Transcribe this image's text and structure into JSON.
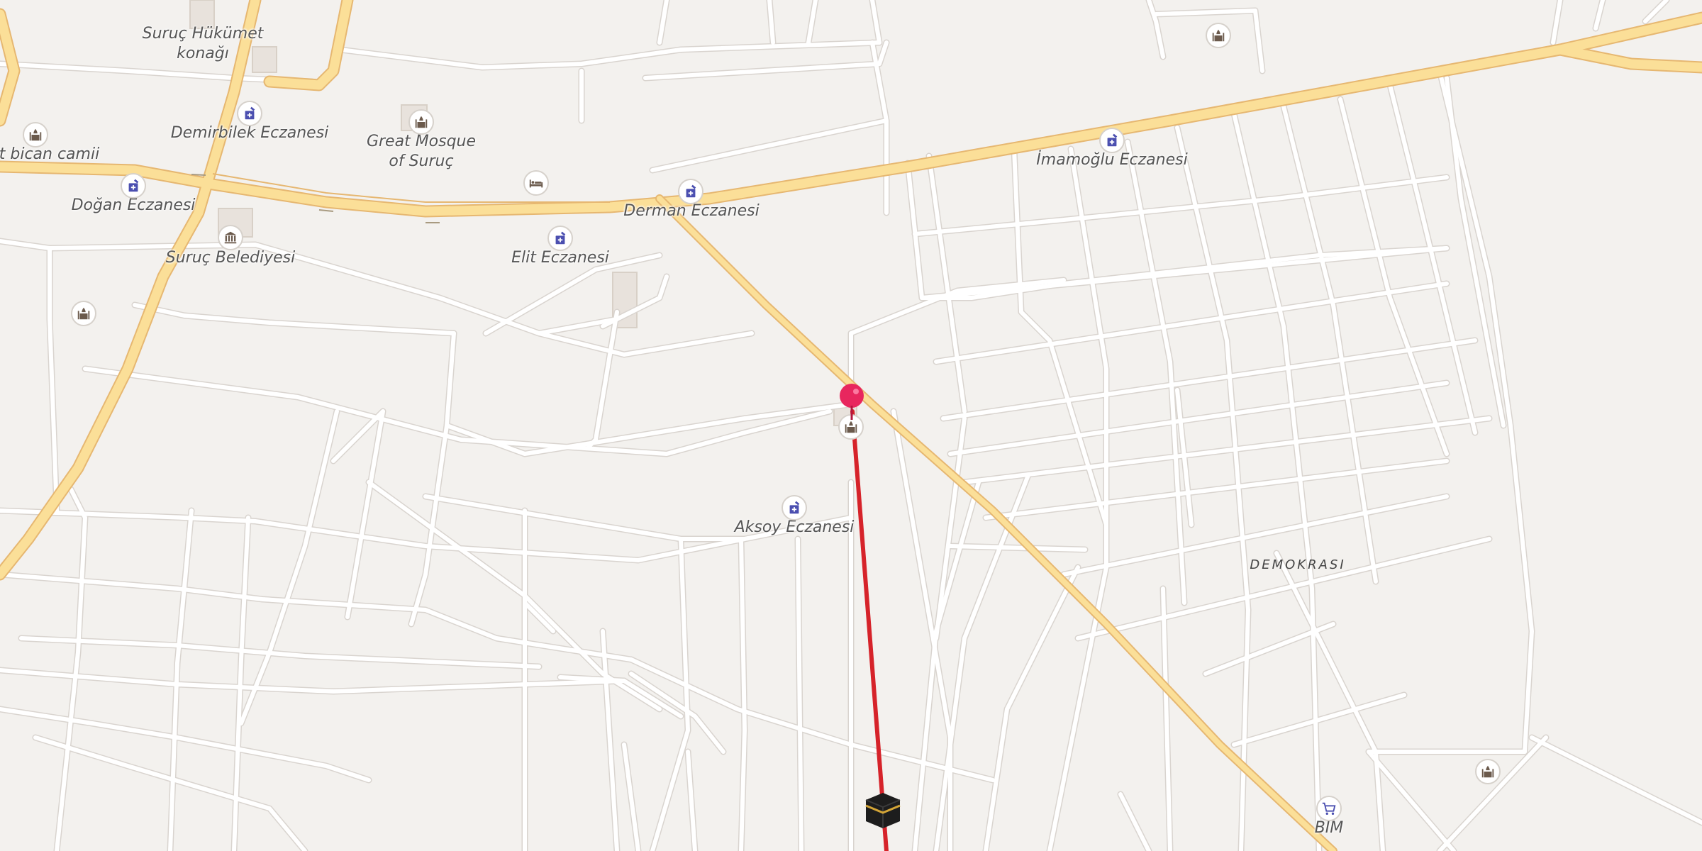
{
  "map": {
    "colors": {
      "background": "#f3f1ee",
      "major_road": "#fbdf98",
      "minor_road": "#ffffff",
      "qibla_line": "#d6232a",
      "pin": "#e8265e"
    },
    "labels": {
      "suruc_hukumet": "Suruç Hükümet\nkonağı",
      "demirbilek": "Demirbilek Eczanesi",
      "great_mosque": "Great Mosque\nof Suruç",
      "bican_camii": "met bican camii",
      "dogan": "Doğan Eczanesi",
      "suruc_belediyesi": "Suruç Belediyesi",
      "elit": "Elit Eczanesi",
      "derman": "Derman Eczanesi",
      "imamoglu": "İmamoğlu Eczanesi",
      "aksoy": "Aksoy Eczanesi",
      "demokrasi": "DEMOKRASI",
      "bim": "BIM"
    },
    "pois": [
      {
        "name": "mosque-icon",
        "label_key": "mosque"
      },
      {
        "name": "pharmacy-icon",
        "label_key": "pharmacy"
      },
      {
        "name": "town-hall-icon",
        "label_key": "town_hall"
      },
      {
        "name": "hotel-icon",
        "label_key": "hotel"
      },
      {
        "name": "shop-cart-icon",
        "label_key": "supermarket"
      },
      {
        "name": "kaaba-icon",
        "label_key": "qibla_direction"
      },
      {
        "name": "location-pin-icon",
        "label_key": "current_location"
      }
    ]
  }
}
